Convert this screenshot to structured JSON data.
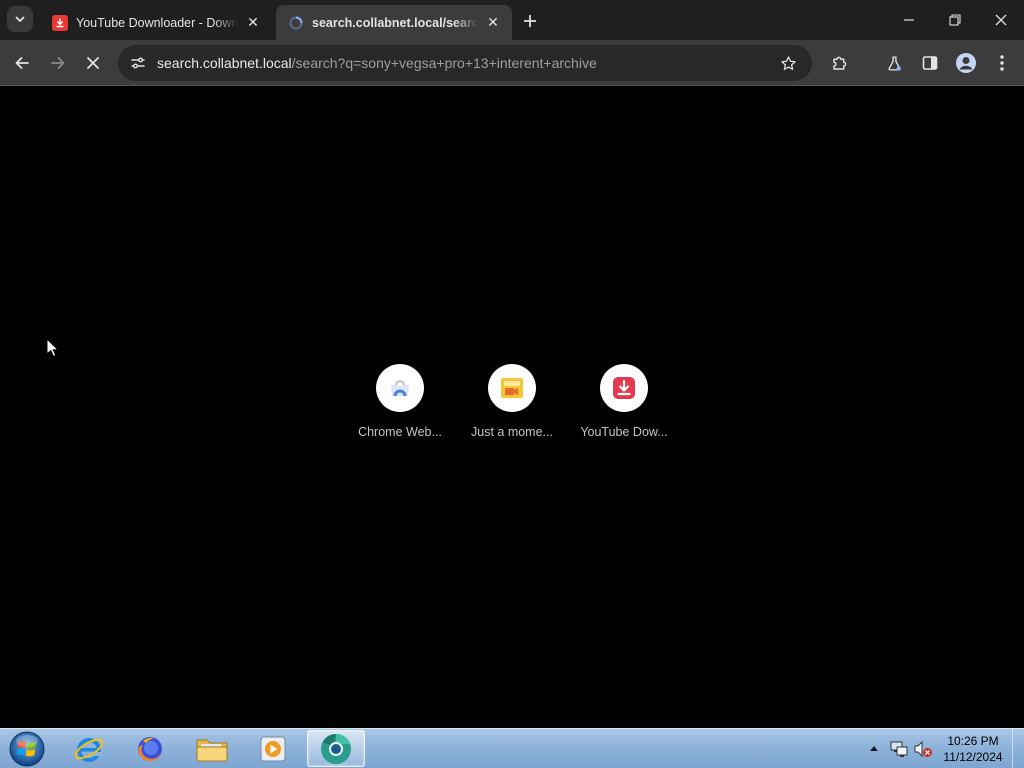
{
  "browser": {
    "tabs": [
      {
        "title": "YouTube Downloader - Download",
        "favicon": "youtube-downloader-icon",
        "active": false
      },
      {
        "title": "search.collabnet.local/search?q=sony",
        "favicon": "loading-spinner-icon",
        "active": true
      }
    ],
    "address": {
      "host": "search.collabnet.local",
      "path": "/search?q=sony+vegsa+pro+13+interent+archive"
    },
    "toolbar_icons": [
      "back-icon",
      "forward-icon",
      "stop-icon",
      "site-info-icon",
      "star-icon",
      "puzzle-icon",
      "flask-icon",
      "side-panel-icon",
      "profile-icon",
      "more-vert-icon"
    ]
  },
  "page": {
    "shortcuts": [
      {
        "label": "Chrome Web...",
        "icon": "chrome-web-store-icon"
      },
      {
        "label": "Just a mome...",
        "icon": "just-a-moment-icon"
      },
      {
        "label": "YouTube Dow...",
        "icon": "youtube-downloader-icon"
      }
    ]
  },
  "taskbar": {
    "apps": [
      "internet-explorer-icon",
      "firefox-icon",
      "explorer-folder-icon",
      "media-player-icon",
      "chrome-icon"
    ],
    "clock": {
      "time": "10:26 PM",
      "date": "11/12/2024"
    }
  },
  "colors": {
    "tabstrip": "#1f1f1f",
    "toolbar": "#3c3c3c",
    "omnibox": "#282828",
    "page_bg": "#000000",
    "yt_red": "#e53935"
  }
}
